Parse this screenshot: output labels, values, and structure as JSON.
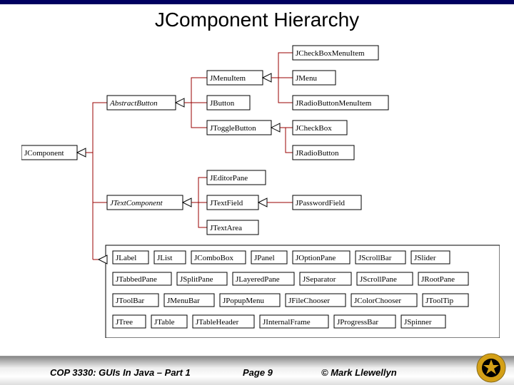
{
  "title": "JComponent Hierarchy",
  "footer": {
    "course": "COP 3330:  GUIs In Java – Part 1",
    "page": "Page 9",
    "copyright": "© Mark Llewellyn"
  },
  "diagram": {
    "root": "JComponent",
    "level2": [
      "AbstractButton",
      "JTextComponent"
    ],
    "abstractButtonChildren": [
      "JMenuItem",
      "JButton",
      "JToggleButton"
    ],
    "jMenuItemChildren": [
      "JCheckBoxMenuItem",
      "JMenu",
      "JRadioButtonMenuItem"
    ],
    "jToggleButtonChildren": [
      "JCheckBox",
      "JRadioButton"
    ],
    "jTextComponentChildren": [
      "JEditorPane",
      "JTextField",
      "JTextArea"
    ],
    "jTextFieldChildren": [
      "JPasswordField"
    ],
    "grid": [
      [
        "JLabel",
        "JList",
        "JComboBox",
        "JPanel",
        "JOptionPane",
        "JScrollBar",
        "JSlider"
      ],
      [
        "JTabbedPane",
        "JSplitPane",
        "JLayeredPane",
        "JSeparator",
        "JScrollPane",
        "JRootPane"
      ],
      [
        "JToolBar",
        "JMenuBar",
        "JPopupMenu",
        "JFileChooser",
        "JColorChooser",
        "JToolTip"
      ],
      [
        "JTree",
        "JTable",
        "JTableHeader",
        "JInternalFrame",
        "JProgressBar",
        "JSpinner"
      ]
    ]
  }
}
